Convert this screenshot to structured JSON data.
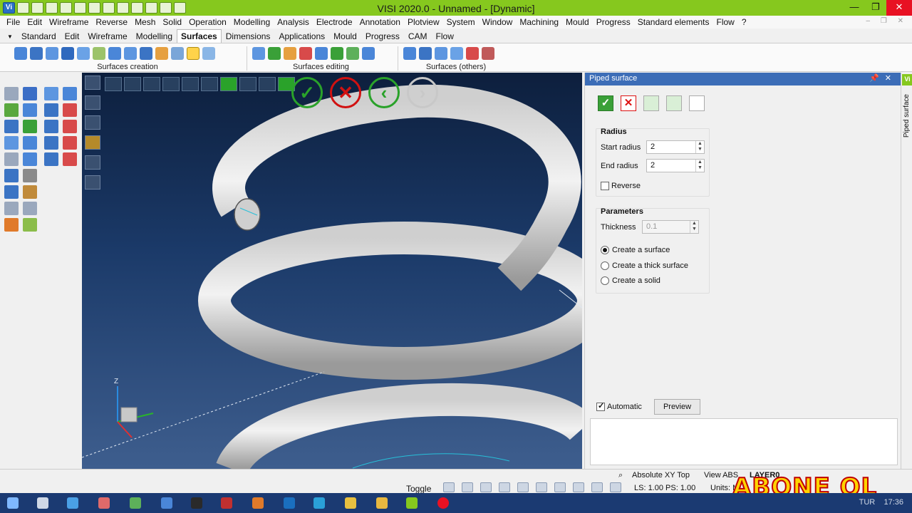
{
  "window": {
    "title": "VISI 2020.0 - Unnamed - [Dynamic]",
    "logo": "Vi",
    "controls": [
      "—",
      "❐",
      "✕"
    ]
  },
  "menu": {
    "items": [
      "File",
      "Edit",
      "Wireframe",
      "Reverse",
      "Mesh",
      "Solid",
      "Operation",
      "Modelling",
      "Analysis",
      "Electrode",
      "Annotation",
      "Plotview",
      "System",
      "Window",
      "Machining",
      "Mould",
      "Progress",
      "Standard elements",
      "Flow",
      "?"
    ]
  },
  "ribbon_tabs": {
    "items": [
      "Standard",
      "Edit",
      "Wireframe",
      "Modelling",
      "Surfaces",
      "Dimensions",
      "Applications",
      "Mould",
      "Progress",
      "CAM",
      "Flow"
    ],
    "active": "Surfaces"
  },
  "ribbon_groups": {
    "g1": "Surfaces creation",
    "g2": "Surfaces editing",
    "g3": "Surfaces (others)"
  },
  "viewport": {
    "axis_z": "Z",
    "confirm_icon": "✓",
    "cancel_icon": "✕",
    "back_icon": "‹",
    "next_icon": "›"
  },
  "panel": {
    "title": "Piped surface",
    "vertical_tab": "Piped surface",
    "radius_group": "Radius",
    "start_radius_label": "Start radius",
    "start_radius_value": "2",
    "end_radius_label": "End radius",
    "end_radius_value": "2",
    "reverse_label": "Reverse",
    "params_group": "Parameters",
    "thickness_label": "Thickness",
    "thickness_value": "0.1",
    "opt_surface": "Create a surface",
    "opt_thick": "Create a thick surface",
    "opt_solid": "Create a solid",
    "automatic_label": "Automatic",
    "preview_label": "Preview"
  },
  "statusbar": {
    "toggle": "Toggle",
    "absolute": "Absolute XY Top",
    "view": "View ABS",
    "layer": "LAYER0",
    "ls": "LS: 1.00 PS: 1.00",
    "units": "Units: M"
  },
  "overlay": {
    "text": "ABONE OL !!!"
  },
  "taskbar": {
    "lang": "TUR",
    "time": "17:36"
  },
  "colors": {
    "titlebar": "#86c81e",
    "accent": "#3c6db7",
    "confirm": "#2aa22a",
    "cancel": "#d11111"
  }
}
